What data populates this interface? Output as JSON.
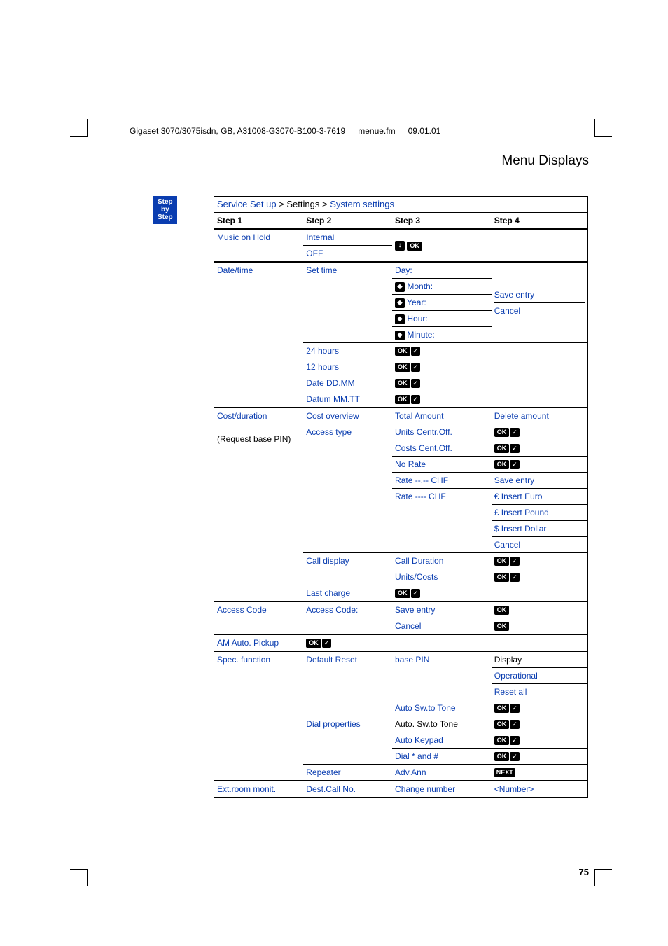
{
  "header": {
    "doc": "Gigaset 3070/3075isdn, GB, A31008-G3070-B100-3-7619",
    "file": "menue.fm",
    "date": "09.01.01"
  },
  "title": "Menu Displays",
  "badge": {
    "l1": "Step",
    "l2": "by",
    "l3": "Step"
  },
  "breadcrumb": {
    "p1": "Service Set up",
    "sep": ">",
    "p2": "Settings",
    "p3": "System settings"
  },
  "cols": {
    "c1": "Step 1",
    "c2": "Step 2",
    "c3": "Step 3",
    "c4": "Step 4"
  },
  "rows": {
    "musicOnHold": "Music on Hold",
    "internal": "Internal",
    "off": "OFF",
    "dateTime": "Date/time",
    "setTime": "Set time",
    "day": "Day:",
    "month": "Month:",
    "year": "Year:",
    "hour": "Hour:",
    "minute": "Minute:",
    "saveEntry": "Save entry",
    "cancel": "Cancel",
    "h24": "24 hours",
    "h12": "12 hours",
    "dateDDMM": "Date DD.MM",
    "datumMMTT": "Datum MM.TT",
    "costDuration": "Cost/duration",
    "requestBase": "(Request base PIN)",
    "costOverview": "Cost overview",
    "totalAmount": "Total Amount",
    "deleteAmount": "Delete amount",
    "accessType": "Access type",
    "unitsCentrOff": "Units Centr.Off.",
    "costsCentOff": "Costs Cent.Off.",
    "noRate": "No Rate",
    "rateDashCHF": "Rate --.-- CHF",
    "rateDashCHF2": "Rate ---- CHF",
    "euroInsert": "€ Insert Euro",
    "poundInsert": "£ Insert Pound",
    "dollarInsert": "$ Insert Dollar",
    "callDisplay": "Call display",
    "callDuration": "Call Duration",
    "unitsCosts": "Units/Costs",
    "lastCharge": "Last charge",
    "accessCode": "Access Code",
    "accessCodeCol": "Access Code:",
    "amAutoPickup": "AM Auto. Pickup",
    "specFunction": "Spec. function",
    "defaultReset": "Default Reset",
    "basePIN": "base PIN",
    "display": "Display",
    "operational": "Operational",
    "resetAll": "Reset all",
    "autoSwToTone": "Auto Sw.to Tone",
    "dialProperties": "Dial properties",
    "autoSwToTone2": "Auto. Sw.to Tone",
    "autoKeypad": "Auto Keypad",
    "dialStarHash": "Dial * and #",
    "repeater": "Repeater",
    "advAnn": "Adv.Ann",
    "extRoomMonit": "Ext.room monit.",
    "destCallNo": "Dest.Call No.",
    "changeNumber": "Change number",
    "number": "<Number>"
  },
  "keys": {
    "ok": "OK",
    "next": "NEXT",
    "check": "✓",
    "down": "↓",
    "right": "◆"
  },
  "pageNum": "75"
}
